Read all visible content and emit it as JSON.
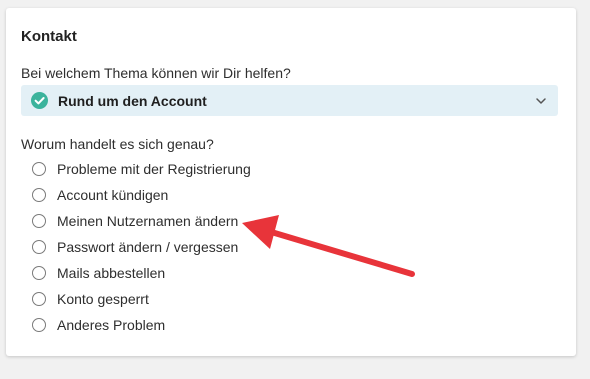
{
  "card": {
    "title": "Kontakt",
    "question_topic": "Bei welchem Thema können wir Dir helfen?",
    "selected_topic": "Rund um den Account",
    "question_detail": "Worum handelt es sich genau?"
  },
  "options": [
    {
      "label": "Probleme mit der Registrierung"
    },
    {
      "label": "Account kündigen"
    },
    {
      "label": "Meinen Nutzernamen ändern"
    },
    {
      "label": "Passwort ändern / vergessen"
    },
    {
      "label": "Mails abbestellen"
    },
    {
      "label": "Konto gesperrt"
    },
    {
      "label": "Anderes Problem"
    }
  ],
  "colors": {
    "select_bg": "#e3f0f6",
    "check": "#3bb39c",
    "annotation_arrow": "#e8343a"
  },
  "icons": {
    "selected": "check-circle-icon",
    "dropdown": "chevron-down-icon",
    "annotation": "red-arrow-annotation"
  }
}
